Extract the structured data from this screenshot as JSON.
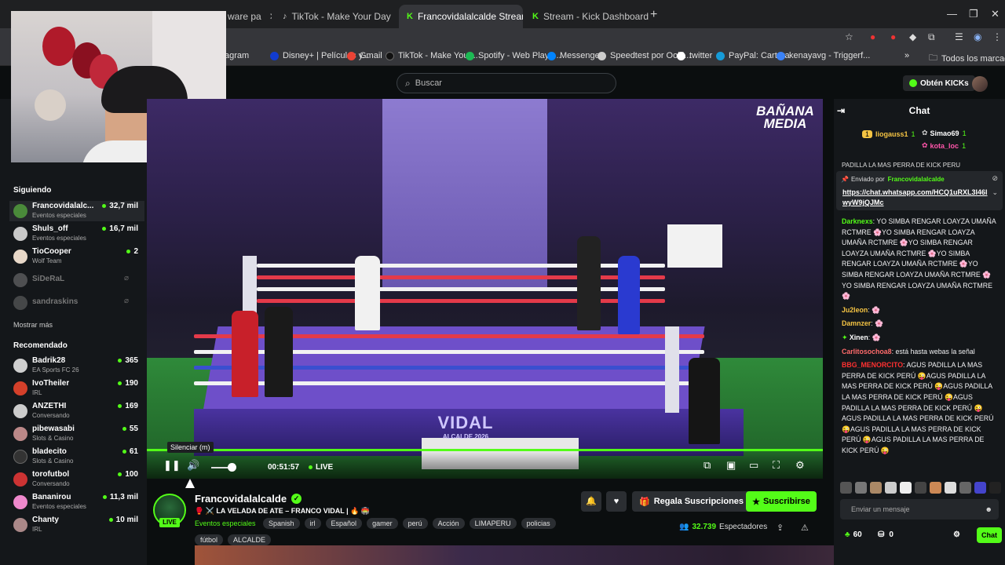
{
  "browser": {
    "tabs": [
      {
        "label": "ware pa",
        "favicon": ""
      },
      {
        "label": "TikTok - Make Your Day",
        "favicon": "tiktok-icon"
      },
      {
        "label": "Francovidalalcalde Stream",
        "favicon": "kick-icon",
        "active": true,
        "audio": true
      },
      {
        "label": "Stream - Kick Dashboard",
        "favicon": "kick-icon"
      }
    ],
    "bookmarks": [
      {
        "label": "agram",
        "color": "#c13584"
      },
      {
        "label": "Disney+ | Películas y...",
        "color": "#113ccf"
      },
      {
        "label": "Gmail",
        "color": "#ea4335"
      },
      {
        "label": "TikTok - Make Your...",
        "color": "#111111"
      },
      {
        "label": "Spotify - Web Playe...",
        "color": "#1db954"
      },
      {
        "label": "Messenger",
        "color": "#0084ff"
      },
      {
        "label": "Speedtest por Ookl...",
        "color": "#cccccc"
      },
      {
        "label": "twitter",
        "color": "#ffffff"
      },
      {
        "label": "PayPal: Cartera",
        "color": "#169bd7"
      },
      {
        "label": "kenayavg - Triggerf...",
        "color": "#3b82f6"
      }
    ],
    "all_bookmarks": "Todos los marcadores",
    "more_bookmarks": "»"
  },
  "header": {
    "search_placeholder": "Buscar",
    "get_kicks": "Obtén KICKs"
  },
  "sidebar": {
    "following_title": "Siguiendo",
    "following": [
      {
        "name": "Francovidalalc...",
        "category": "Eventos especiales",
        "viewers": "32,7 mil",
        "color": "#4a8a3a",
        "active": true
      },
      {
        "name": "Shuls_off",
        "category": "Eventos especiales",
        "viewers": "16,7 mil",
        "color": "#c9c9c9"
      },
      {
        "name": "TioCooper",
        "category": "Wolf Team",
        "viewers": "2",
        "color": "#e8d8c8"
      },
      {
        "name": "SiDeRaL",
        "offline": true,
        "color": "#888"
      },
      {
        "name": "sandraskins",
        "offline": true,
        "color": "#777"
      }
    ],
    "show_more": "Mostrar más",
    "recommended_title": "Recomendado",
    "recommended": [
      {
        "name": "Badrik28",
        "category": "EA Sports FC 26",
        "viewers": "365",
        "color": "#cfcfcf"
      },
      {
        "name": "IvoTheiler",
        "category": "IRL",
        "viewers": "190",
        "color": "#d4402a"
      },
      {
        "name": "ANZETHI",
        "category": "Conversando",
        "viewers": "169",
        "color": "#ccc"
      },
      {
        "name": "pibewasabi",
        "category": "Slots & Casino",
        "viewers": "55",
        "color": "#b88"
      },
      {
        "name": "bladecito",
        "category": "Slots & Casino",
        "viewers": "61",
        "color": "#333"
      },
      {
        "name": "torofutbol",
        "category": "Conversando",
        "viewers": "100",
        "color": "#c33"
      },
      {
        "name": "Bananirou",
        "category": "Eventos especiales",
        "viewers": "11,3 mil",
        "color": "#e8c"
      },
      {
        "name": "Chanty",
        "category": "IRL",
        "viewers": "10 mil",
        "color": "#a88"
      }
    ]
  },
  "player": {
    "logo": "BAÑANA MEDIA",
    "banner_name": "VIDAL",
    "banner_sub": "ALCALDE 2026",
    "tooltip": "Silenciar (m)",
    "time": "00:51:57",
    "live_label": "LIVE",
    "volume_level": 0.7
  },
  "stream": {
    "channel": "Francovidalalcalde",
    "live_badge": "LIVE",
    "title": "🥊 ⚔️ LA VELADA DE ATE – FRANCO VIDAL | 🔥 🏟️",
    "category": "Eventos especiales",
    "tags": [
      "Spanish",
      "irl",
      "Español",
      "gamer",
      "perú",
      "Acción",
      "LIMAPERU",
      "policias"
    ],
    "tags2": [
      "fútbol",
      "ALCALDE"
    ],
    "gift_subs": "Regala Suscripciones",
    "subscribe": "Suscribirse",
    "viewers": "32.739",
    "viewers_label": "Espectadores"
  },
  "chat": {
    "title": "Chat",
    "gifters": [
      {
        "rank": "1",
        "name": "liogauss1",
        "count": "1"
      },
      {
        "name": "Simao69",
        "count": "1"
      },
      {
        "name": "kota_loc",
        "count": "1"
      }
    ],
    "cut_line": "PADILLA LA MAS PERRA DE KICK PERU",
    "pinned_by": "Enviado por",
    "pinned_user": "Francovidalalcalde",
    "pinned_link": "https://chat.whatsapp.com/HCQ1uRXL3I46lwyW9jQJMc",
    "messages": [
      {
        "user": "Darknexs",
        "color": "#53fc18",
        "text": "YO SIMBA RENGAR LOAYZA UMAÑA RCTMRE 🌸YO SIMBA RENGAR LOAYZA UMAÑA RCTMRE 🌸YO SIMBA RENGAR LOAYZA UMAÑA RCTMRE 🌸YO SIMBA RENGAR LOAYZA UMAÑA RCTMRE 🌸YO SIMBA RENGAR LOAYZA UMAÑA RCTMRE 🌸YO SIMBA RENGAR LOAYZA UMAÑA RCTMRE 🌸"
      },
      {
        "user": "Ju2leon",
        "color": "#f5c443",
        "text": "🌸"
      },
      {
        "user": "Damnzer",
        "color": "#f5c443",
        "text": "🌸"
      },
      {
        "user": "Xinen",
        "color": "#ffffff",
        "text": "🌸"
      },
      {
        "user": "Carlitosochoa8",
        "color": "#ff6b6b",
        "text": "está hasta webas la señal"
      },
      {
        "user": "BBG_MENORCITO",
        "color": "#ff3030",
        "text": "AGUS PADILLA LA MAS PERRA DE KICK PERÚ 😜AGUS PADILLA LA MAS PERRA DE KICK PERÚ 😜AGUS PADILLA LA MAS PERRA DE KICK PERÚ 😜AGUS PADILLA LA MAS PERRA DE KICK PERÚ 😜AGUS PADILLA LA MAS PERRA DE KICK PERÚ 😜AGUS PADILLA LA MAS PERRA DE KICK PERÚ 😜AGUS PADILLA LA MAS PERRA DE KICK PERÚ 😜"
      }
    ],
    "input_placeholder": "Enviar un mensaje",
    "points": "60",
    "drops": "0",
    "chat_button": "Chat"
  }
}
